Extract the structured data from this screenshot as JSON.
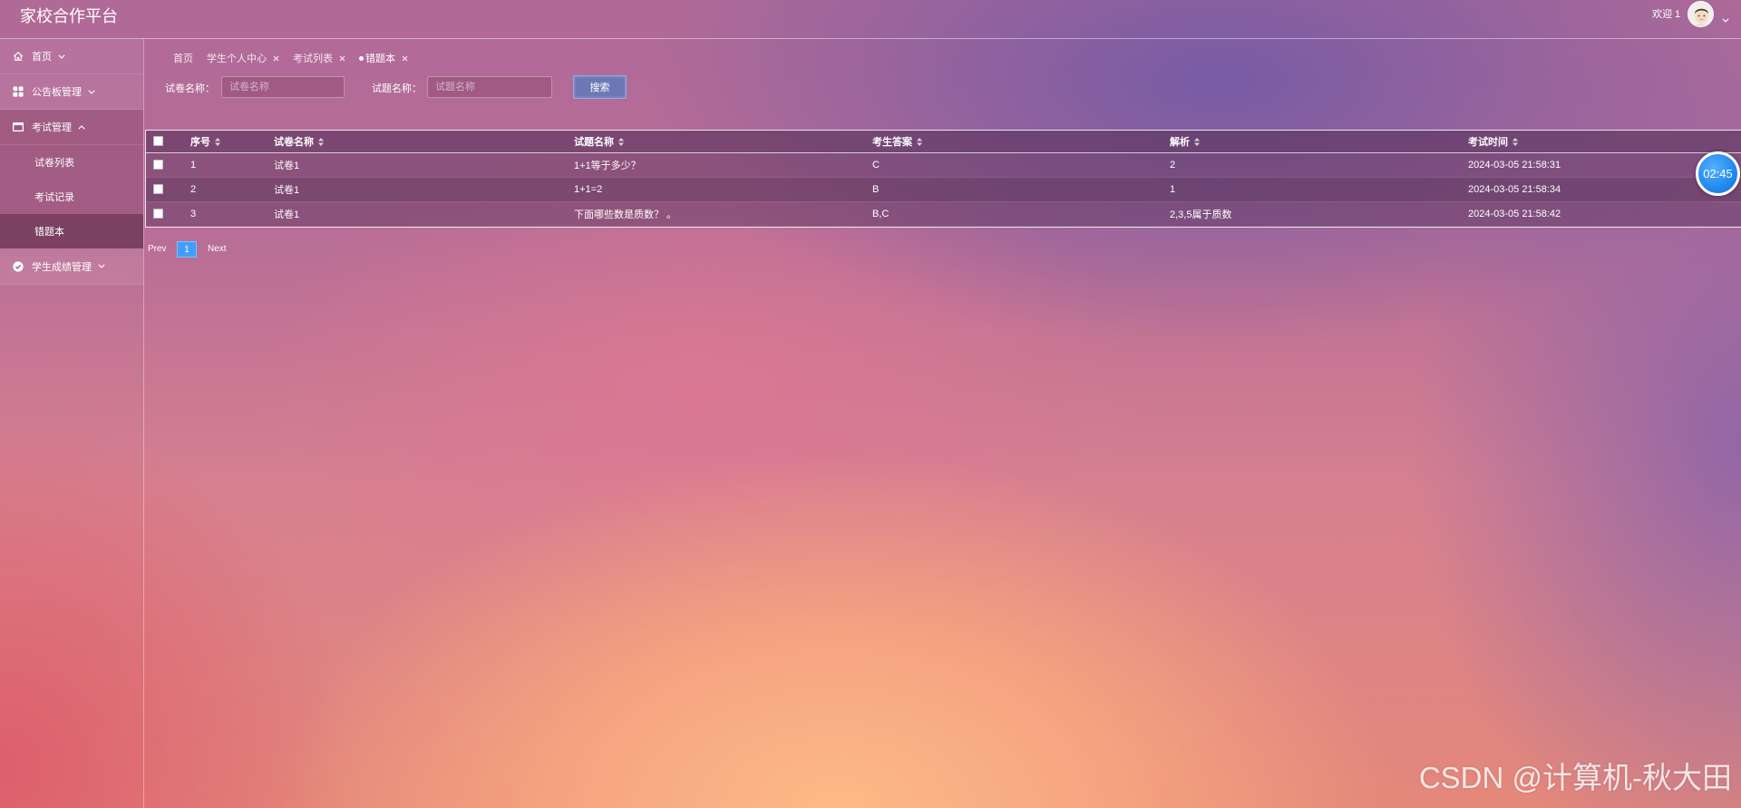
{
  "app": {
    "title": "家校合作平台"
  },
  "header": {
    "welcome": "欢迎 1",
    "avatar_icon": "avatar",
    "dropdown_icon": "chevron-down-icon"
  },
  "sidebar": {
    "items": [
      {
        "label": "首页",
        "icon": "home-icon",
        "expanded": false
      },
      {
        "label": "公告板管理",
        "icon": "grid-icon",
        "expanded": false
      },
      {
        "label": "考试管理",
        "icon": "card-icon",
        "expanded": true,
        "children": [
          {
            "label": "试卷列表",
            "active": false
          },
          {
            "label": "考试记录",
            "active": false
          },
          {
            "label": "错题本",
            "active": true
          }
        ]
      },
      {
        "label": "学生成绩管理",
        "icon": "check-circle-icon",
        "expanded": false
      }
    ]
  },
  "tabs": [
    {
      "label": "首页",
      "closable": false,
      "active": false
    },
    {
      "label": "学生个人中心",
      "closable": true,
      "active": false
    },
    {
      "label": "考试列表",
      "closable": true,
      "active": false
    },
    {
      "label": "错题本",
      "closable": true,
      "active": true
    }
  ],
  "search": {
    "paper_label": "试卷名称：",
    "paper_placeholder": "试卷名称",
    "paper_value": "",
    "question_label": "试题名称：",
    "question_placeholder": "试题名称",
    "question_value": "",
    "button": "搜索"
  },
  "table": {
    "columns": [
      "序号",
      "试卷名称",
      "试题名称",
      "考生答案",
      "解析",
      "考试时间"
    ],
    "rows": [
      [
        "1",
        "试卷1",
        "1+1等于多少？",
        "C",
        "2",
        "2024-03-05 21:58:31"
      ],
      [
        "2",
        "试卷1",
        "1+1=2",
        "B",
        "1",
        "2024-03-05 21:58:34"
      ],
      [
        "3",
        "试卷1",
        "下面哪些数是质数？ 。",
        "B,C",
        "2,3,5属于质数",
        "2024-03-05 21:58:42"
      ]
    ]
  },
  "pagination": {
    "prev": "Prev",
    "current": "1",
    "next": "Next"
  },
  "timer": {
    "value": "02:45"
  },
  "watermark": "CSDN @计算机-秋大田",
  "colors": {
    "accent": "#409eff",
    "search_button": "#6c78b6",
    "timer": "#2288ee",
    "text": "#ffffff"
  }
}
